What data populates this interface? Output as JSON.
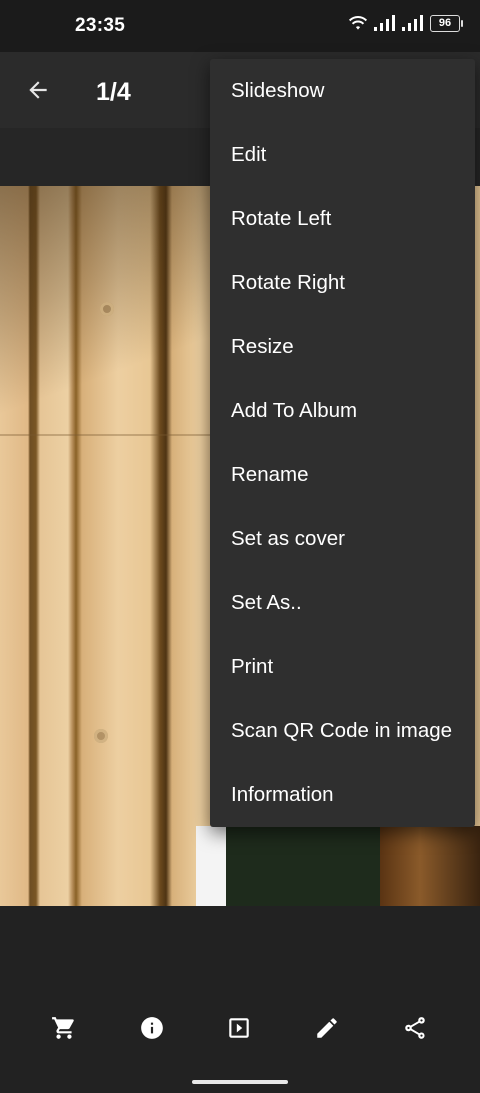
{
  "status_bar": {
    "time": "23:35",
    "battery_level": "96"
  },
  "app_bar": {
    "counter": "1/4"
  },
  "menu": {
    "items": [
      {
        "label": "Slideshow"
      },
      {
        "label": "Edit"
      },
      {
        "label": "Rotate Left"
      },
      {
        "label": "Rotate Right"
      },
      {
        "label": "Resize"
      },
      {
        "label": "Add To Album"
      },
      {
        "label": "Rename"
      },
      {
        "label": "Set as cover"
      },
      {
        "label": "Set As.."
      },
      {
        "label": "Print"
      },
      {
        "label": "Scan QR Code in image"
      },
      {
        "label": "Information"
      }
    ]
  },
  "toolbar": {
    "icons": [
      "cart-icon",
      "info-icon",
      "slideshow-icon",
      "edit-pencil-icon",
      "share-icon"
    ]
  },
  "colors": {
    "background": "#222222",
    "menu_background": "#2f2f2f",
    "app_bar": "#2b2b2b"
  }
}
